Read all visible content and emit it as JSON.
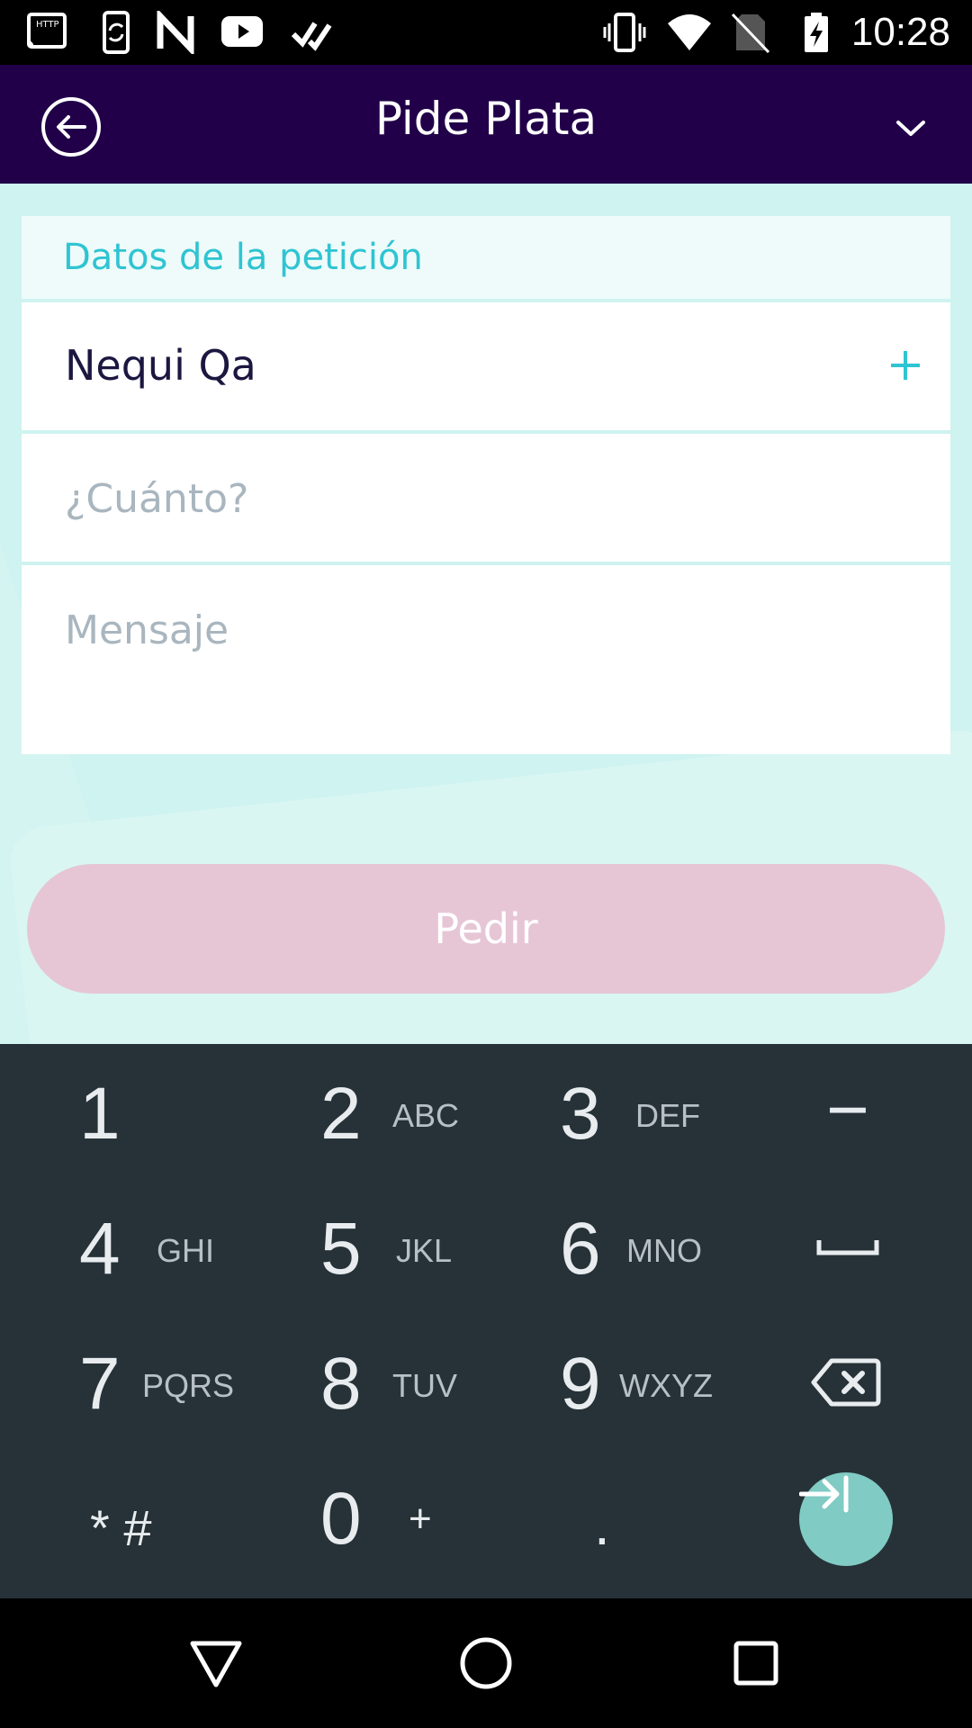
{
  "status_bar": {
    "time": "10:28",
    "left_icons": [
      "cast-http-icon",
      "sync-phone-icon",
      "n-app-icon",
      "youtube-icon",
      "check-app-icon"
    ],
    "right_icons": [
      "vibrate-icon",
      "wifi-icon",
      "no-sim-icon",
      "battery-charging-icon"
    ]
  },
  "header": {
    "title": "Pide Plata",
    "back_icon": "back-arrow-icon",
    "menu_icon": "chevron-down-icon"
  },
  "form": {
    "section_title": "Datos de la petición",
    "recipient_name": "Nequi Qa",
    "amount_placeholder": "¿Cuánto?",
    "message_placeholder": "Mensaje",
    "submit_label": "Pedir"
  },
  "colors": {
    "header_bg": "#210049",
    "accent": "#2fc4d2",
    "submit_disabled": "#e6c6d5",
    "keyboard_bg": "#263238",
    "go_button": "#80cbc4"
  },
  "keyboard": {
    "keys": [
      {
        "num": "1",
        "letters": ""
      },
      {
        "num": "2",
        "letters": "ABC"
      },
      {
        "num": "3",
        "letters": "DEF"
      },
      {
        "num": "−",
        "letters": ""
      },
      {
        "num": "4",
        "letters": "GHI"
      },
      {
        "num": "5",
        "letters": "JKL"
      },
      {
        "num": "6",
        "letters": "MNO"
      },
      {
        "num": "space",
        "letters": ""
      },
      {
        "num": "7",
        "letters": "PQRS"
      },
      {
        "num": "8",
        "letters": "TUV"
      },
      {
        "num": "9",
        "letters": "WXYZ"
      },
      {
        "num": "backspace",
        "letters": ""
      },
      {
        "num": "* #",
        "letters": ""
      },
      {
        "num": "0",
        "letters": "+"
      },
      {
        "num": ".",
        "letters": ""
      },
      {
        "num": "go",
        "letters": ""
      }
    ]
  },
  "nav_bar": {
    "icons": [
      "back-triangle-icon",
      "home-circle-icon",
      "recents-square-icon"
    ]
  }
}
